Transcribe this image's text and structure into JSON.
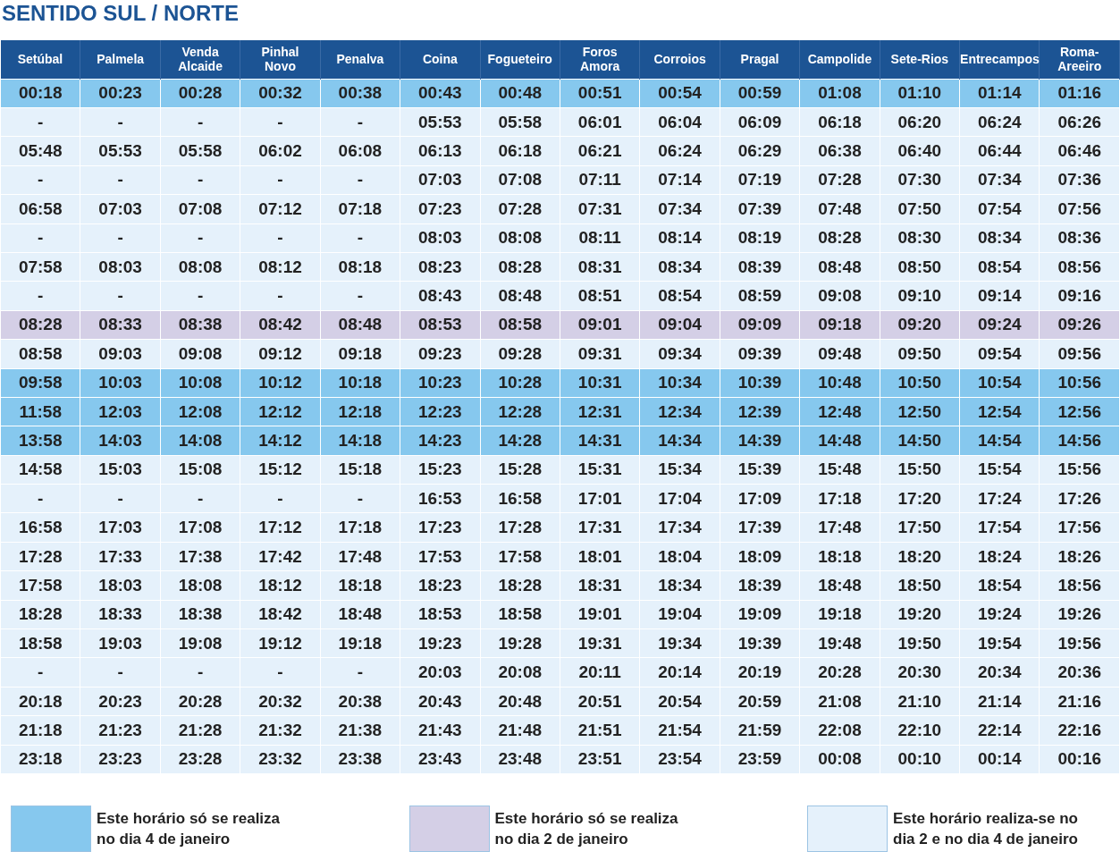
{
  "title": "SENTIDO SUL / NORTE",
  "table": {
    "columns": [
      "Setúbal",
      "Palmela",
      "Venda\nAlcaide",
      "Pinhal\nNovo",
      "Penalva",
      "Coina",
      "Fogueteiro",
      "Foros\nAmora",
      "Corroios",
      "Pragal",
      "Campolide",
      "Sete-Rios",
      "Entrecampos",
      "Roma-\nAreeiro"
    ],
    "rows": [
      {
        "kind": "jan4",
        "cells": [
          "00:18",
          "00:23",
          "00:28",
          "00:32",
          "00:38",
          "00:43",
          "00:48",
          "00:51",
          "00:54",
          "00:59",
          "01:08",
          "01:10",
          "01:14",
          "01:16"
        ]
      },
      {
        "kind": "both",
        "cells": [
          "-",
          "-",
          "-",
          "-",
          "-",
          "05:53",
          "05:58",
          "06:01",
          "06:04",
          "06:09",
          "06:18",
          "06:20",
          "06:24",
          "06:26"
        ]
      },
      {
        "kind": "both",
        "cells": [
          "05:48",
          "05:53",
          "05:58",
          "06:02",
          "06:08",
          "06:13",
          "06:18",
          "06:21",
          "06:24",
          "06:29",
          "06:38",
          "06:40",
          "06:44",
          "06:46"
        ]
      },
      {
        "kind": "both",
        "cells": [
          "-",
          "-",
          "-",
          "-",
          "-",
          "07:03",
          "07:08",
          "07:11",
          "07:14",
          "07:19",
          "07:28",
          "07:30",
          "07:34",
          "07:36"
        ]
      },
      {
        "kind": "both",
        "cells": [
          "06:58",
          "07:03",
          "07:08",
          "07:12",
          "07:18",
          "07:23",
          "07:28",
          "07:31",
          "07:34",
          "07:39",
          "07:48",
          "07:50",
          "07:54",
          "07:56"
        ]
      },
      {
        "kind": "both",
        "cells": [
          "-",
          "-",
          "-",
          "-",
          "-",
          "08:03",
          "08:08",
          "08:11",
          "08:14",
          "08:19",
          "08:28",
          "08:30",
          "08:34",
          "08:36"
        ]
      },
      {
        "kind": "both",
        "cells": [
          "07:58",
          "08:03",
          "08:08",
          "08:12",
          "08:18",
          "08:23",
          "08:28",
          "08:31",
          "08:34",
          "08:39",
          "08:48",
          "08:50",
          "08:54",
          "08:56"
        ]
      },
      {
        "kind": "both",
        "cells": [
          "-",
          "-",
          "-",
          "-",
          "-",
          "08:43",
          "08:48",
          "08:51",
          "08:54",
          "08:59",
          "09:08",
          "09:10",
          "09:14",
          "09:16"
        ]
      },
      {
        "kind": "jan2",
        "cells": [
          "08:28",
          "08:33",
          "08:38",
          "08:42",
          "08:48",
          "08:53",
          "08:58",
          "09:01",
          "09:04",
          "09:09",
          "09:18",
          "09:20",
          "09:24",
          "09:26"
        ]
      },
      {
        "kind": "both",
        "cells": [
          "08:58",
          "09:03",
          "09:08",
          "09:12",
          "09:18",
          "09:23",
          "09:28",
          "09:31",
          "09:34",
          "09:39",
          "09:48",
          "09:50",
          "09:54",
          "09:56"
        ]
      },
      {
        "kind": "jan4",
        "cells": [
          "09:58",
          "10:03",
          "10:08",
          "10:12",
          "10:18",
          "10:23",
          "10:28",
          "10:31",
          "10:34",
          "10:39",
          "10:48",
          "10:50",
          "10:54",
          "10:56"
        ]
      },
      {
        "kind": "jan4",
        "cells": [
          "11:58",
          "12:03",
          "12:08",
          "12:12",
          "12:18",
          "12:23",
          "12:28",
          "12:31",
          "12:34",
          "12:39",
          "12:48",
          "12:50",
          "12:54",
          "12:56"
        ]
      },
      {
        "kind": "jan4",
        "cells": [
          "13:58",
          "14:03",
          "14:08",
          "14:12",
          "14:18",
          "14:23",
          "14:28",
          "14:31",
          "14:34",
          "14:39",
          "14:48",
          "14:50",
          "14:54",
          "14:56"
        ]
      },
      {
        "kind": "both",
        "cells": [
          "14:58",
          "15:03",
          "15:08",
          "15:12",
          "15:18",
          "15:23",
          "15:28",
          "15:31",
          "15:34",
          "15:39",
          "15:48",
          "15:50",
          "15:54",
          "15:56"
        ]
      },
      {
        "kind": "both",
        "cells": [
          "-",
          "-",
          "-",
          "-",
          "-",
          "16:53",
          "16:58",
          "17:01",
          "17:04",
          "17:09",
          "17:18",
          "17:20",
          "17:24",
          "17:26"
        ]
      },
      {
        "kind": "both",
        "cells": [
          "16:58",
          "17:03",
          "17:08",
          "17:12",
          "17:18",
          "17:23",
          "17:28",
          "17:31",
          "17:34",
          "17:39",
          "17:48",
          "17:50",
          "17:54",
          "17:56"
        ]
      },
      {
        "kind": "both",
        "cells": [
          "17:28",
          "17:33",
          "17:38",
          "17:42",
          "17:48",
          "17:53",
          "17:58",
          "18:01",
          "18:04",
          "18:09",
          "18:18",
          "18:20",
          "18:24",
          "18:26"
        ]
      },
      {
        "kind": "both",
        "cells": [
          "17:58",
          "18:03",
          "18:08",
          "18:12",
          "18:18",
          "18:23",
          "18:28",
          "18:31",
          "18:34",
          "18:39",
          "18:48",
          "18:50",
          "18:54",
          "18:56"
        ]
      },
      {
        "kind": "both",
        "cells": [
          "18:28",
          "18:33",
          "18:38",
          "18:42",
          "18:48",
          "18:53",
          "18:58",
          "19:01",
          "19:04",
          "19:09",
          "19:18",
          "19:20",
          "19:24",
          "19:26"
        ]
      },
      {
        "kind": "both",
        "cells": [
          "18:58",
          "19:03",
          "19:08",
          "19:12",
          "19:18",
          "19:23",
          "19:28",
          "19:31",
          "19:34",
          "19:39",
          "19:48",
          "19:50",
          "19:54",
          "19:56"
        ]
      },
      {
        "kind": "both",
        "cells": [
          "-",
          "-",
          "-",
          "-",
          "-",
          "20:03",
          "20:08",
          "20:11",
          "20:14",
          "20:19",
          "20:28",
          "20:30",
          "20:34",
          "20:36"
        ]
      },
      {
        "kind": "both",
        "cells": [
          "20:18",
          "20:23",
          "20:28",
          "20:32",
          "20:38",
          "20:43",
          "20:48",
          "20:51",
          "20:54",
          "20:59",
          "21:08",
          "21:10",
          "21:14",
          "21:16"
        ]
      },
      {
        "kind": "both",
        "cells": [
          "21:18",
          "21:23",
          "21:28",
          "21:32",
          "21:38",
          "21:43",
          "21:48",
          "21:51",
          "21:54",
          "21:59",
          "22:08",
          "22:10",
          "22:14",
          "22:16"
        ]
      },
      {
        "kind": "both",
        "cells": [
          "23:18",
          "23:23",
          "23:28",
          "23:32",
          "23:38",
          "23:43",
          "23:48",
          "23:51",
          "23:54",
          "23:59",
          "00:08",
          "00:10",
          "00:14",
          "00:16"
        ]
      }
    ]
  },
  "legend": [
    {
      "kind": "jan4",
      "text": "Este horário só se realiza\nno dia 4 de janeiro"
    },
    {
      "kind": "jan2",
      "text": "Este horário só se realiza\nno dia 2 de janeiro"
    },
    {
      "kind": "both",
      "text": "Este horário realiza-se no\ndia 2 e no dia 4 de janeiro"
    }
  ]
}
